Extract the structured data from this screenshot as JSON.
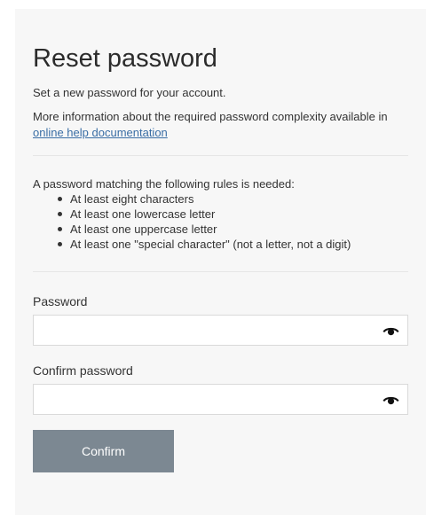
{
  "header": {
    "title": "Reset password",
    "subtitle": "Set a new password for your account."
  },
  "info": {
    "prefix": "More information about the required password complexity available in ",
    "link_text": "online help documentation"
  },
  "rules": {
    "intro": "A password matching the following rules is needed:",
    "items": [
      "At least eight characters",
      "At least one lowercase letter",
      "At least one uppercase letter",
      "At least one \"special character\" (not a letter, not a digit)"
    ]
  },
  "form": {
    "password_label": "Password",
    "password_value": "",
    "confirm_label": "Confirm password",
    "confirm_value": "",
    "reveal_icon": "eye-icon",
    "submit_label": "Confirm",
    "submit_color": "#7c8892"
  }
}
